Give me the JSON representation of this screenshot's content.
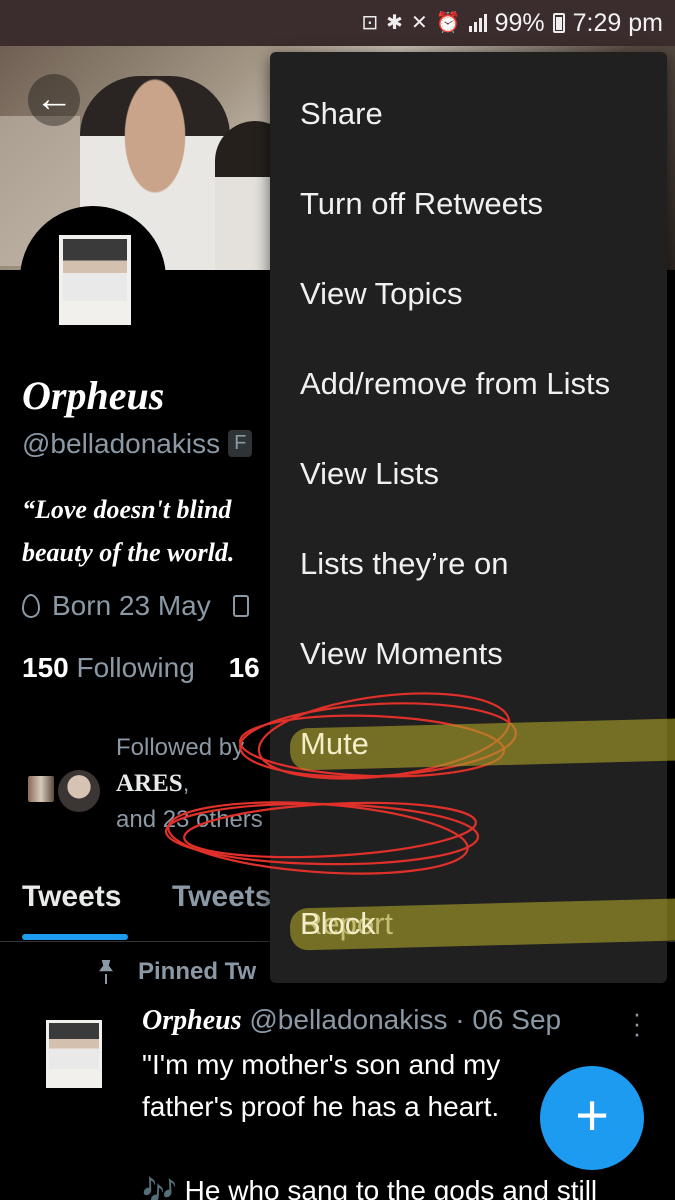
{
  "status_bar": {
    "battery": "99%",
    "time": "7:29 pm"
  },
  "banner": {
    "back_icon": "arrow-left-icon"
  },
  "profile": {
    "name": "Orpheus",
    "handle": "@belladonakiss",
    "follows_badge": "F",
    "bio_line1": "“Love doesn't blind",
    "bio_line2": "beauty of the world.",
    "birthday": "Born 23 May",
    "following_count": "150",
    "following_label": "Following",
    "followers_count": "16"
  },
  "followed_by": {
    "line1": "Followed by",
    "user": "ARES",
    "comma": ",",
    "line3": "and 23 others"
  },
  "tabs": [
    {
      "label": "Tweets"
    },
    {
      "label": "Tweets"
    }
  ],
  "tweet": {
    "pinned_label": "Pinned Tw",
    "author": "Orpheus",
    "meta": "@belladonakiss · 06 Sep",
    "line1": "\"I'm my mother's son and my",
    "line2": "father's proof he has a heart.",
    "line3_icon": "🎶",
    "line3": "He who sang to the gods and still"
  },
  "menu": {
    "items": [
      {
        "label": "Share"
      },
      {
        "label": "Turn off Retweets"
      },
      {
        "label": "View Topics"
      },
      {
        "label": "Add/remove from Lists"
      },
      {
        "label": "View Lists"
      },
      {
        "label": "Lists they’re on"
      },
      {
        "label": "View Moments"
      },
      {
        "label": "Mute"
      },
      {
        "label": "Block"
      },
      {
        "label": "Report"
      }
    ]
  },
  "fab": {
    "label": "+"
  },
  "colors": {
    "accent": "#1d9bf0",
    "menu_bg": "#202020",
    "annotation_red": "#e0302a",
    "highlight": "#aaa028"
  }
}
